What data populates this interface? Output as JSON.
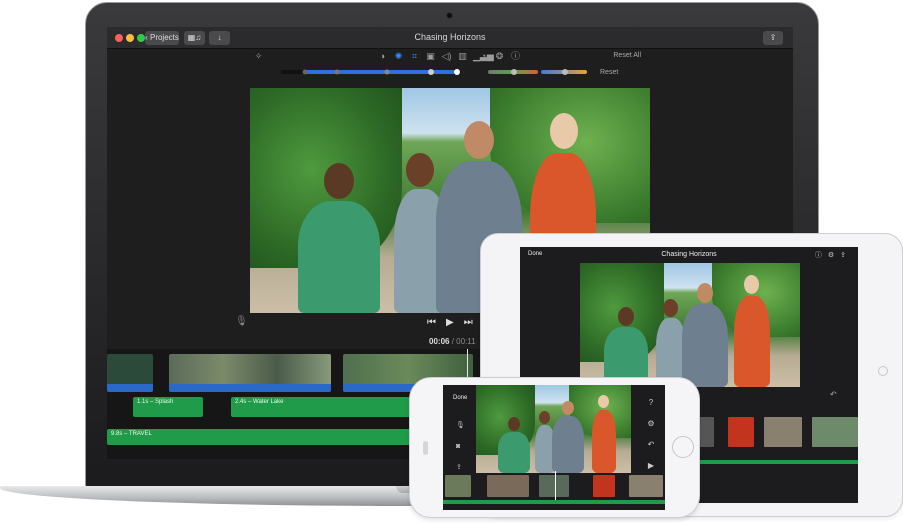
{
  "mac": {
    "window_title": "Chasing Horizons",
    "projects_button": "Projects",
    "reset_all": "Reset All",
    "reset": "Reset",
    "timecode_current": "00:06",
    "timecode_separator": " / ",
    "timecode_total": "00:11",
    "audio_clips": [
      "1.1s – Splash",
      "2.4s – Water Lake",
      "9.8s – TRAVEL"
    ],
    "colors": {
      "accent": "#2f8bff",
      "audio": "#1f9b4a",
      "video_underline": "#2b69c8"
    }
  },
  "ipad": {
    "title": "Chasing Horizons",
    "done": "Done"
  },
  "iphone": {
    "done": "Done"
  },
  "icons": [
    "close-dot",
    "minimize-dot",
    "zoom-dot",
    "chevron-left-icon",
    "media-browser-icon",
    "download-icon",
    "share-icon",
    "magic-wand-icon",
    "color-balance-icon",
    "color-correction-icon",
    "crop-icon",
    "stabilization-icon",
    "volume-icon",
    "equalizer-icon",
    "speed-icon",
    "filter-icon",
    "info-icon",
    "microphone-icon",
    "skip-back-icon",
    "play-icon",
    "skip-forward-icon",
    "help-icon",
    "settings-icon",
    "undo-icon",
    "camera-icon"
  ]
}
